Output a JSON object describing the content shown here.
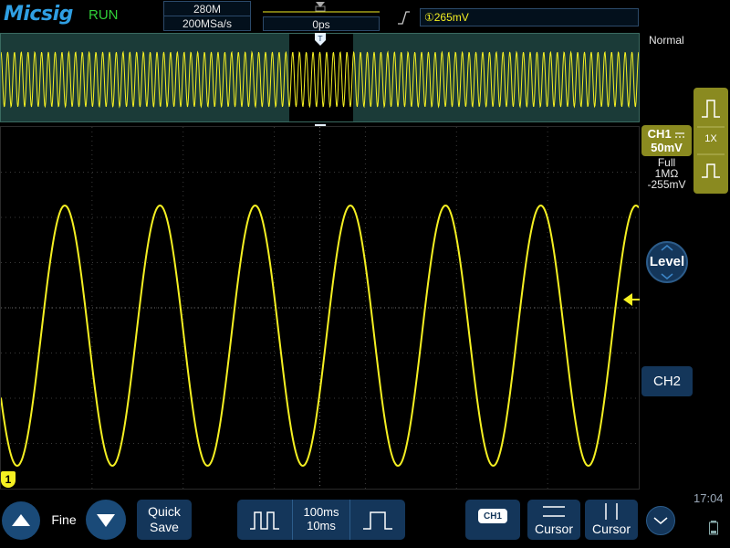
{
  "brand": "Micsig",
  "status": "RUN",
  "acquisition": {
    "memory_depth": "280M",
    "sample_rate": "200MSa/s"
  },
  "timebase": {
    "delay": "0ps"
  },
  "trigger": {
    "level_readout": "①265mV",
    "mode": "Normal"
  },
  "channel1": {
    "tag_name": "CH1",
    "scale": "50mV",
    "coupling_icon": "dc-coupling-icon",
    "bandwidth": "Full",
    "impedance": "1MΩ",
    "offset": "-255mV",
    "marker": "1",
    "probe": "1X"
  },
  "controls": {
    "level_label": "Level",
    "ch2_label": "CH2",
    "fine_label": "Fine",
    "quick_save_line1": "Quick",
    "quick_save_line2": "Save",
    "timebase_line1": "100ms",
    "timebase_line2": "10ms",
    "ch1_chip": "CH1",
    "cursor_h_label": "Cursor",
    "cursor_v_label": "Cursor"
  },
  "clock": "17:04",
  "colors": {
    "accent": "#2f9fe3",
    "run": "#30d038",
    "ch1": "#f5f022",
    "panel": "#14365a"
  },
  "waveform": {
    "main_cycles": 6.7,
    "overview_cycles": 94
  }
}
